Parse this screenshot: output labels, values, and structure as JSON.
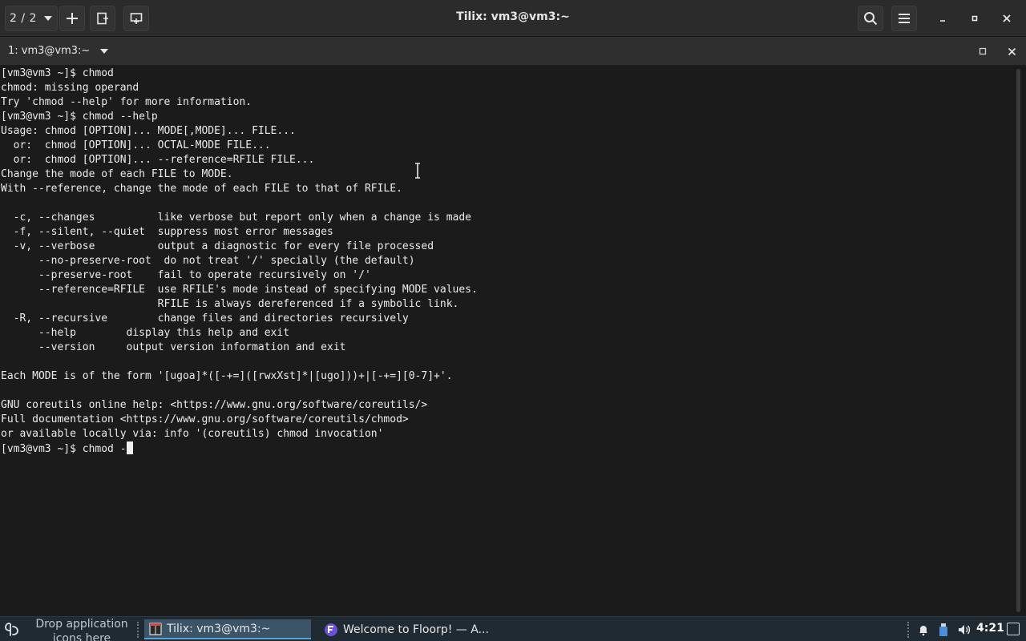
{
  "window": {
    "title": "Tilix: vm3@vm3:~",
    "session_label": "2 / 2"
  },
  "terminal_header": {
    "title": "1: vm3@vm3:~"
  },
  "terminal": {
    "lines": [
      "[vm3@vm3 ~]$ chmod",
      "chmod: missing operand",
      "Try 'chmod --help' for more information.",
      "[vm3@vm3 ~]$ chmod --help",
      "Usage: chmod [OPTION]... MODE[,MODE]... FILE...",
      "  or:  chmod [OPTION]... OCTAL-MODE FILE...",
      "  or:  chmod [OPTION]... --reference=RFILE FILE...",
      "Change the mode of each FILE to MODE.",
      "With --reference, change the mode of each FILE to that of RFILE.",
      "",
      "  -c, --changes          like verbose but report only when a change is made",
      "  -f, --silent, --quiet  suppress most error messages",
      "  -v, --verbose          output a diagnostic for every file processed",
      "      --no-preserve-root  do not treat '/' specially (the default)",
      "      --preserve-root    fail to operate recursively on '/'",
      "      --reference=RFILE  use RFILE's mode instead of specifying MODE values.",
      "                         RFILE is always dereferenced if a symbolic link.",
      "  -R, --recursive        change files and directories recursively",
      "      --help        display this help and exit",
      "      --version     output version information and exit",
      "",
      "Each MODE is of the form '[ugoa]*([-+=]([rwxXst]*|[ugo]))+|[-+=][0-7]+'.",
      "",
      "GNU coreutils online help: <https://www.gnu.org/software/coreutils/>",
      "Full documentation <https://www.gnu.org/software/coreutils/chmod>",
      "or available locally via: info '(coreutils) chmod invocation'"
    ],
    "prompt_line": "[vm3@vm3 ~]$ chmod -"
  },
  "taskbar": {
    "drop_line1": "Drop application",
    "drop_line2": "icons here",
    "tasks": [
      {
        "label": "Tilix: vm3@vm3:~"
      },
      {
        "label": "Welcome to Floorp! — A..."
      }
    ],
    "clock": "4:21"
  },
  "colors": {
    "terminal_bg": "#1b1b1b",
    "taskbar_bg": "#1f2a33",
    "active_task": "#3b5468"
  }
}
